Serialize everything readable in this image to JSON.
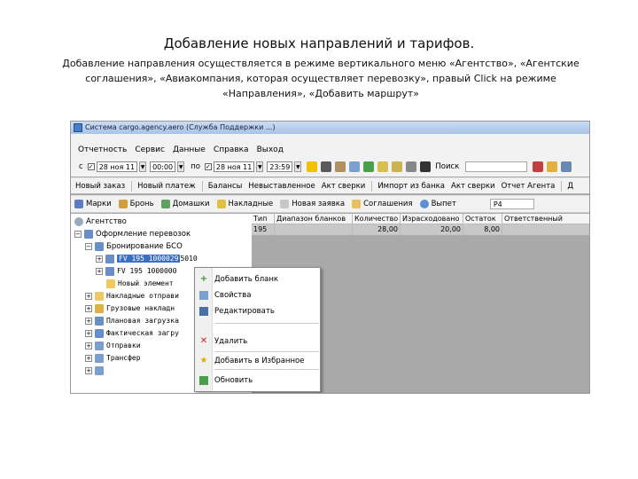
{
  "slide": {
    "title": "Добавление новых направлений и тарифов.",
    "description": "Добавление направления осуществляется в режиме вертикального меню «Агентство», «Агентские соглашения», «Авиакомпания, которая осуществляет перевозку», правый Click на режиме «Направления», «Добавить маршрут»"
  },
  "window": {
    "title": "Система cargo.agency.aero (Служба Поддержки ...)"
  },
  "menu": [
    "Отчетность",
    "Сервис",
    "Данные",
    "Справка",
    "Выход"
  ],
  "filters": {
    "from_label": "с",
    "from_date": "28 ноя 11",
    "from_time": "00:00",
    "to_label": "по",
    "to_date": "28 ноя 11",
    "to_time": "23:59",
    "search_label": "Поиск"
  },
  "toolbar2": [
    "Новый заказ",
    "Новый платеж",
    "Балансы",
    "Невыставленное",
    "Акт сверки",
    "Импорт из банка",
    "Акт сверки",
    "Отчет Агента",
    "Д"
  ],
  "toolbar3": {
    "buttons": [
      "Марки",
      "Бронь",
      "Домашки",
      "Накладные",
      "Новая заявка",
      "Соглашения",
      "Выпет"
    ],
    "p4": "Р4"
  },
  "tree": {
    "root": "Агентство",
    "n1": "Оформление перевозок",
    "n2": "Бронирование БСО",
    "n3": "FV 195 1000029",
    "n3b": "5010",
    "n4": "FV 195 1000000",
    "n5": "Новый элемент",
    "n6": "Накладные отправи",
    "n7": "Грузовые накладн",
    "n8": "Плановая загрузка",
    "n9": "Фактическая загру",
    "n10": "Отправки",
    "n11": "Трансфер"
  },
  "grid": {
    "headers": [
      "Тип",
      "Диапазон бланков",
      "Количество",
      "Израсходовано",
      "Остаток",
      "Ответственный"
    ],
    "row": [
      "195",
      "",
      "28,00",
      "20,00",
      "8,00",
      ""
    ]
  },
  "context_menu": {
    "add": "Добавить бланк",
    "props": "Свойства",
    "edit": "Редактировать",
    "delete": "Удалить",
    "favorite": "Добавить в Избранное",
    "refresh": "Обновить"
  },
  "colors": {
    "selection": "#3a6fc4",
    "grid_empty": "#a9a9a9",
    "toolbar_bg": "#f2f2f2"
  }
}
